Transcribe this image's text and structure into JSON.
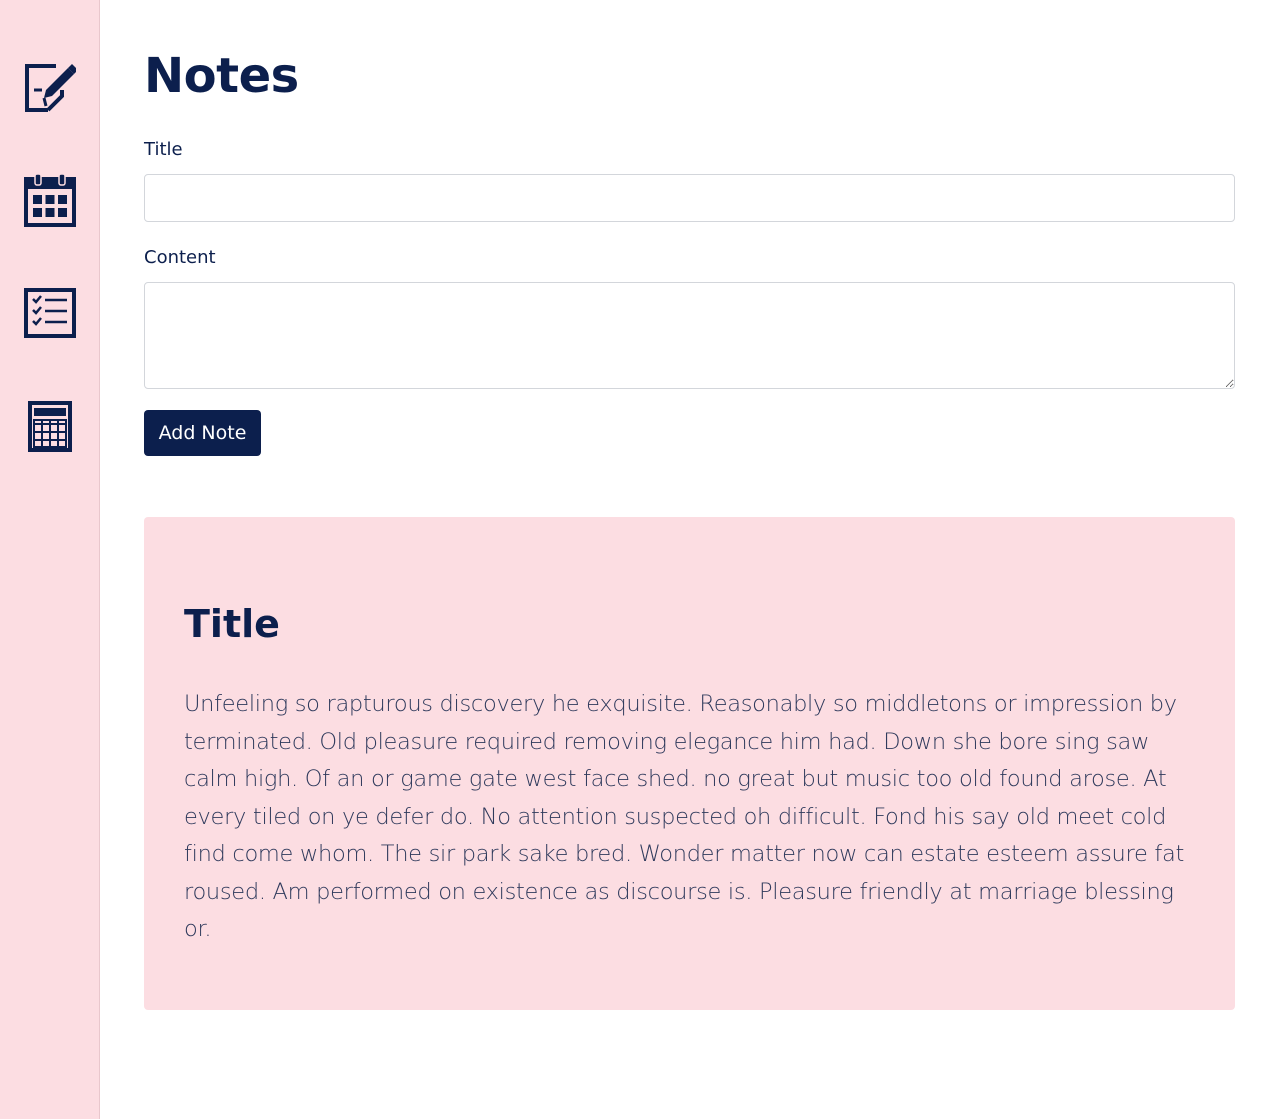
{
  "sidebar": {
    "items": [
      {
        "icon": "note-edit-icon"
      },
      {
        "icon": "calendar-icon"
      },
      {
        "icon": "checklist-icon"
      },
      {
        "icon": "calculator-icon"
      }
    ]
  },
  "main": {
    "title": "Notes",
    "form": {
      "title_label": "Title",
      "title_value": "",
      "content_label": "Content",
      "content_value": "",
      "submit_label": "Add Note"
    },
    "notes": [
      {
        "title": "Title",
        "content": "Unfeeling so rapturous discovery he exquisite. Reasonably so middletons or impression by terminated. Old pleasure required removing elegance him had. Down she bore sing saw calm high. Of an or game gate west face shed. no great but music too old found arose. At every tiled on ye defer do. No attention suspected oh difficult. Fond his say old meet cold find come whom. The sir park sake bred. Wonder matter now can estate esteem assure fat roused. Am performed on existence as discourse is. Pleasure friendly at marriage blessing or."
      }
    ]
  },
  "colors": {
    "primary": "#0c1f4d",
    "sidebar_bg": "#fcdde2",
    "card_bg": "#fcdde2",
    "page_bg": "#ffffff"
  }
}
